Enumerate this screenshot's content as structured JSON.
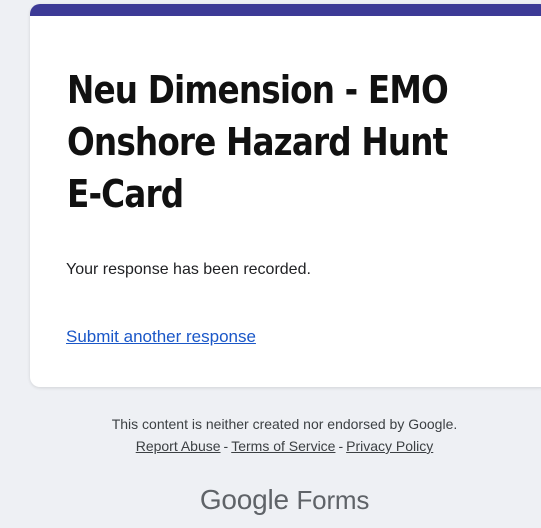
{
  "form": {
    "title": "Neu Dimension - EMO Onshore Hazard Hunt E-Card",
    "confirmation": "Your response has been recorded.",
    "submit_another": "Submit another response"
  },
  "footer": {
    "disclaimer": "This content is neither created nor endorsed by Google.",
    "report_abuse": "Report Abuse",
    "terms": "Terms of Service",
    "privacy": "Privacy Policy",
    "separator": "-"
  },
  "brand": {
    "google": "Google",
    "forms": "Forms"
  },
  "colors": {
    "accent": "#3c3a96",
    "link": "#1a57c8",
    "background": "#eef0f4"
  }
}
